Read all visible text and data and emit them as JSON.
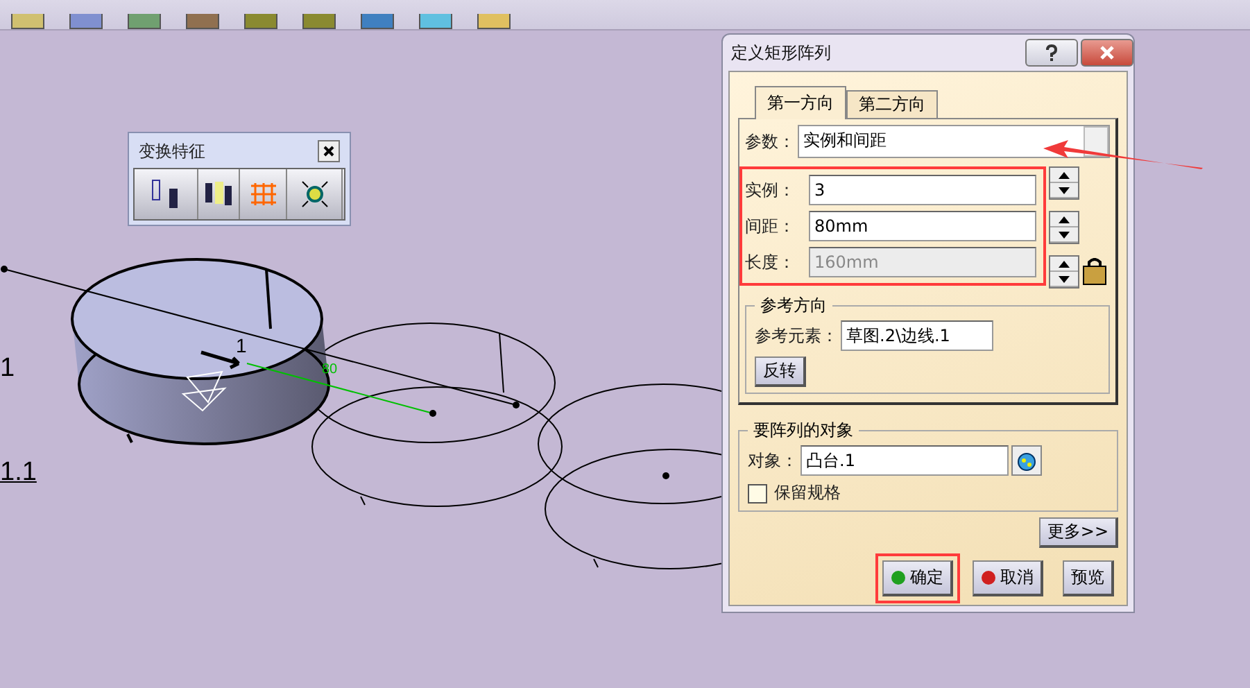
{
  "canvas": {
    "tree_labels": [
      "1",
      "1.1"
    ],
    "dimension_labels": [
      "1",
      "80"
    ]
  },
  "floating_toolbar": {
    "title": "变换特征"
  },
  "dialog": {
    "title": "定义矩形阵列",
    "tabs": [
      {
        "label": "第一方向",
        "selected": true
      },
      {
        "label": "第二方向",
        "selected": false
      }
    ],
    "parameters": {
      "label": "参数：",
      "value": "实例和间距"
    },
    "fields_highlighted": true,
    "fields": [
      {
        "label": "实例：",
        "value": "3",
        "disabled": false
      },
      {
        "label": "间距：",
        "value": "80mm",
        "disabled": false
      },
      {
        "label": "长度：",
        "value": "160mm",
        "disabled": true
      }
    ],
    "reference": {
      "title": "参考方向",
      "label": "参考元素：",
      "value": "草图.2\\边线.1",
      "button": "反转"
    },
    "object": {
      "title": "要阵列的对象",
      "label": "对象：",
      "value": "凸台.1",
      "checkbox": {
        "label": "保留规格",
        "checked": false
      }
    },
    "more_button": "更多>>",
    "buttons": [
      {
        "label": "确定",
        "kind": "ok",
        "highlighted": true
      },
      {
        "label": "取消",
        "kind": "cancel",
        "highlighted": false
      },
      {
        "label": "预览",
        "kind": "preview",
        "highlighted": false
      }
    ]
  }
}
